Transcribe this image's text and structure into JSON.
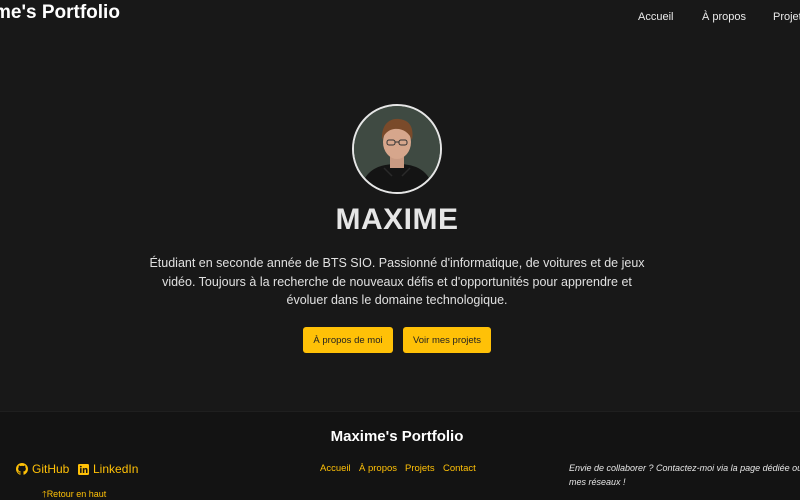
{
  "header": {
    "brand": "me's Portfolio",
    "nav": [
      "Accueil",
      "À propos",
      "Projets"
    ]
  },
  "hero": {
    "avatar_alt": "photo de profil",
    "name": "MAXIME",
    "description": "Étudiant en seconde année de BTS SIO. Passionné d'informatique, de voitures et de jeux vidéo. Toujours à la recherche de nouveaux défis et d'opportunités pour apprendre et évoluer dans le domaine technologique.",
    "buttons": [
      "À propos de moi",
      "Voir mes projets"
    ]
  },
  "footer": {
    "title": "Maxime's Portfolio",
    "social": {
      "github": "GitHub",
      "linkedin": "LinkedIn"
    },
    "back_to_top": "Retour en haut",
    "nav": [
      "Accueil",
      "À propos",
      "Projets",
      "Contact"
    ],
    "note": "Envie de collaborer ? Contactez-moi via la page dédiée ou sur mes réseaux !"
  },
  "colors": {
    "background": "#181818",
    "accent": "#ffc107",
    "footer_background": "#131313"
  }
}
